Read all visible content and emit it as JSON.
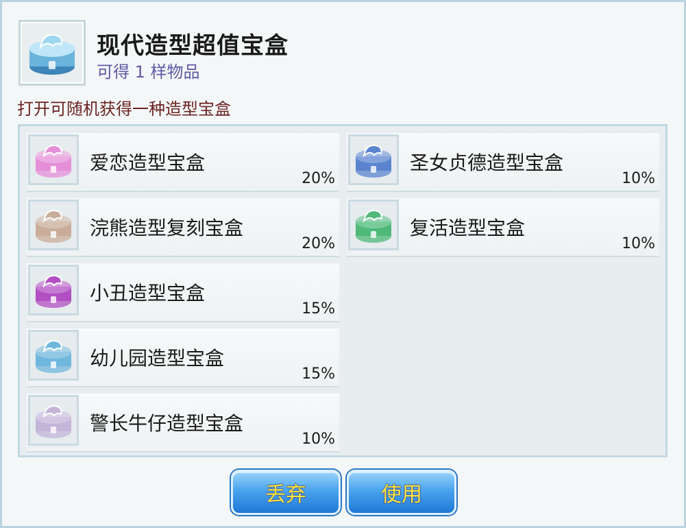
{
  "header": {
    "title": "现代造型超值宝盒",
    "subtitle": "可得 1 样物品",
    "icon": "blue-cake-box-icon",
    "icon_color": "#7fc6e6"
  },
  "description": "打开可随机获得一种造型宝盒",
  "items_left": [
    {
      "name": "爱恋造型宝盒",
      "pct": "20%",
      "icon": "pink-cake-box-icon",
      "color": "#e58fd9"
    },
    {
      "name": "浣熊造型复刻宝盒",
      "pct": "20%",
      "icon": "beige-cake-box-icon",
      "color": "#c9ad9a"
    },
    {
      "name": "小丑造型宝盒",
      "pct": "15%",
      "icon": "purple-cake-box-icon",
      "color": "#b24fc2"
    },
    {
      "name": "幼儿园造型宝盒",
      "pct": "15%",
      "icon": "blue-cake-box-icon",
      "color": "#6fb7dc"
    },
    {
      "name": "警长牛仔造型宝盒",
      "pct": "10%",
      "icon": "lavender-cake-box-icon",
      "color": "#c3b5d8"
    }
  ],
  "items_right": [
    {
      "name": "圣女贞德造型宝盒",
      "pct": "10%",
      "icon": "navy-cake-box-icon",
      "color": "#5b84cf"
    },
    {
      "name": "复活造型宝盒",
      "pct": "10%",
      "icon": "green-cake-box-icon",
      "color": "#4fb97a"
    }
  ],
  "buttons": {
    "discard": "丢弃",
    "use": "使用"
  }
}
